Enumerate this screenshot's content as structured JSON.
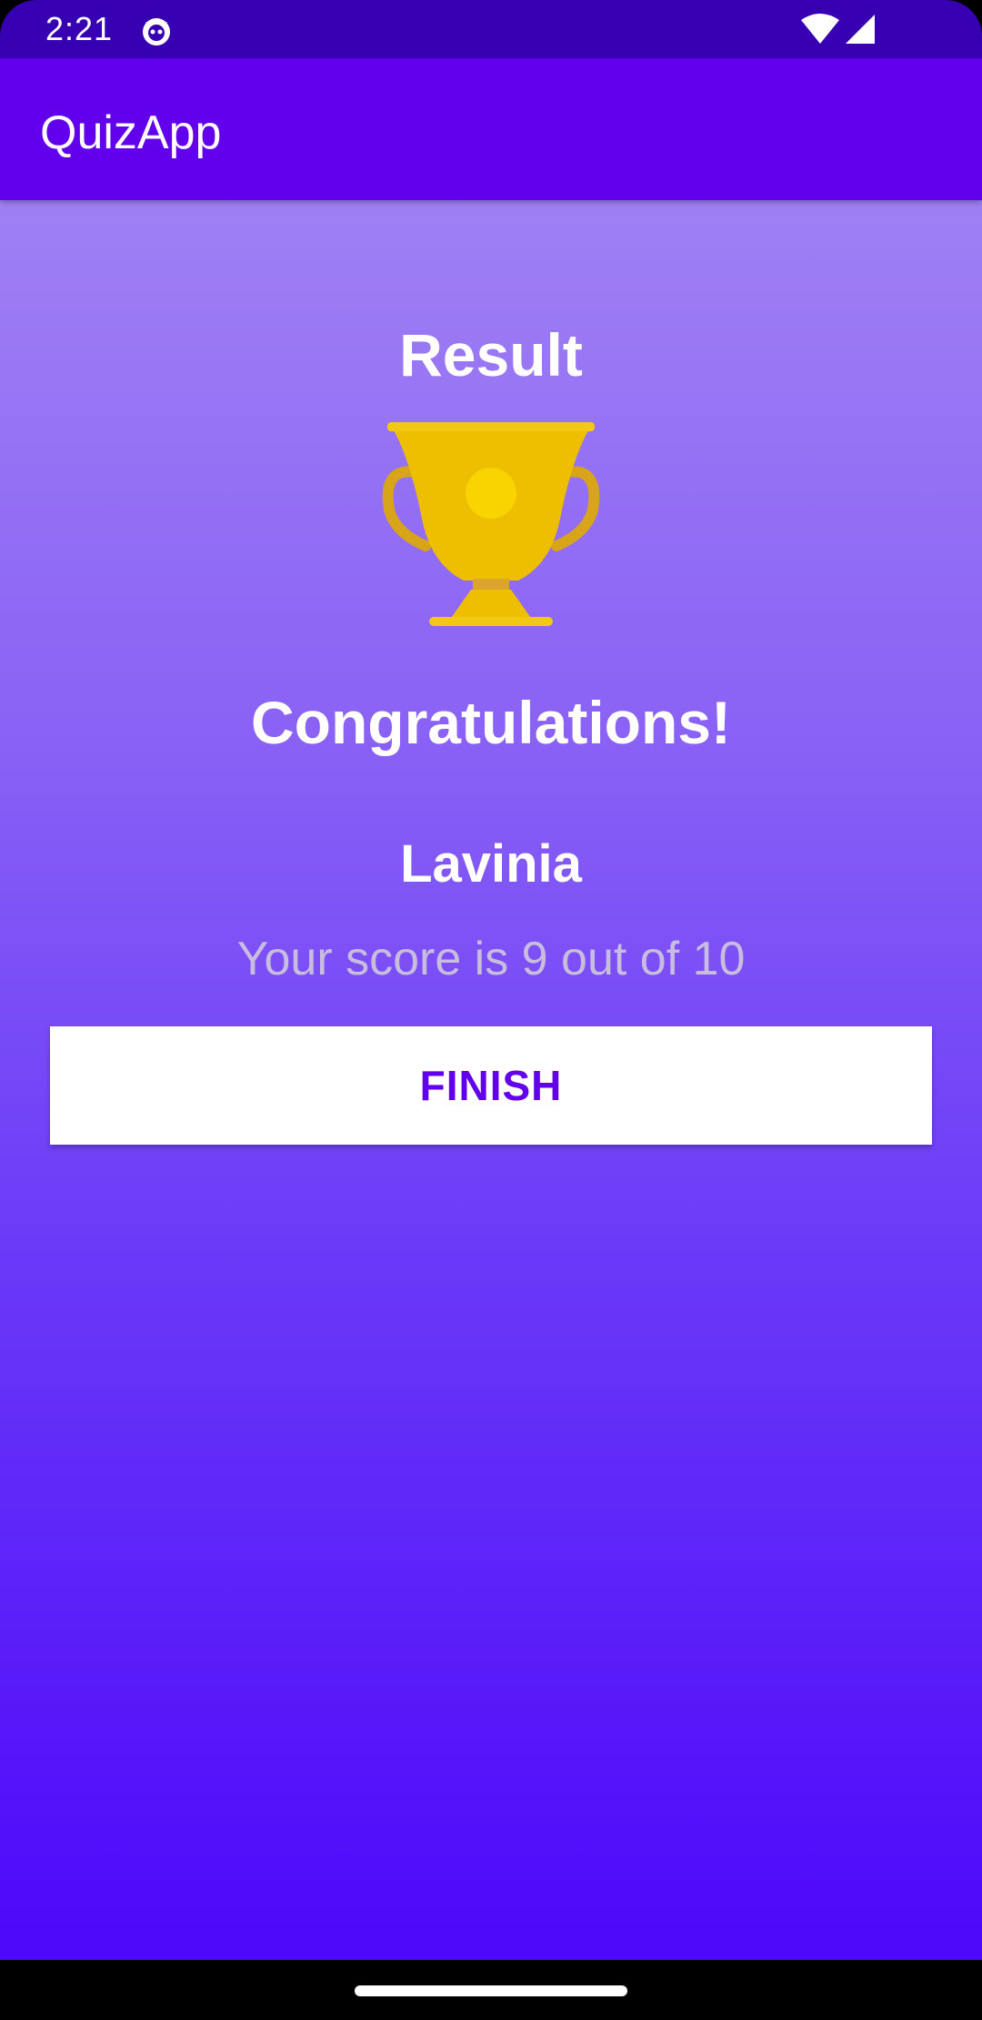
{
  "status_bar": {
    "time": "2:21",
    "icons": [
      "app-notification-icon",
      "wifi-icon",
      "cell-signal-icon"
    ]
  },
  "app_bar": {
    "title": "QuizApp"
  },
  "result": {
    "title": "Result",
    "trophy_icon": "trophy-icon",
    "congrats": "Congratulations!",
    "name": "Lavinia",
    "score_text": "Your score is 9 out of 10",
    "finish_label": "FINISH"
  },
  "colors": {
    "status_bar": "#3700b3",
    "app_bar": "#6200ee",
    "gradient_top": "#9f80f4",
    "gradient_bottom": "#4d07fa",
    "button_text": "#6200ee",
    "trophy_gold": "#eebf00"
  }
}
